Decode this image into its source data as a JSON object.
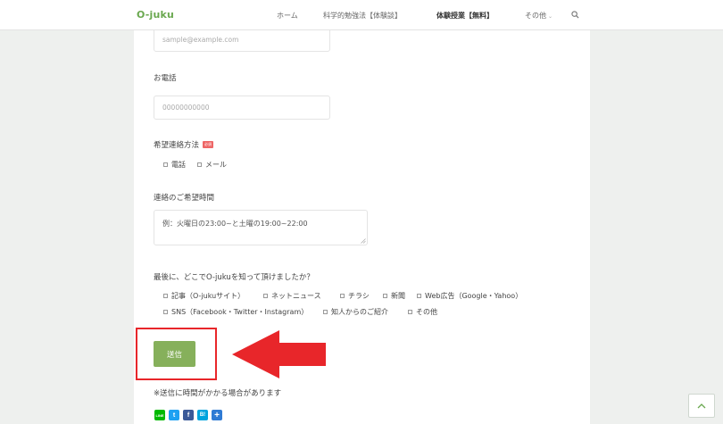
{
  "header": {
    "logo": "O-juku",
    "nav": [
      "ホーム",
      "科学的勉強法【体験談】",
      "体験授業【無料】",
      "その他"
    ],
    "more_caret": "⌄"
  },
  "form": {
    "email_placeholder": "sample@example.com",
    "phone_label": "お電話",
    "phone_placeholder": "00000000000",
    "contact_method_label": "希望連絡方法",
    "required_badge": "必須",
    "contact_methods": [
      "電話",
      "メール"
    ],
    "time_label": "連絡のご希望時間",
    "time_placeholder": "例：火曜日の23:00~と土曜の19:00~22:00",
    "referral_label": "最後に、どこでO-jukuを知って頂けましたか？",
    "referral_options": [
      "記事（O-jukuサイト）",
      "ネットニュース",
      "チラシ",
      "新聞",
      "Web広告（Google・Yahoo）",
      "SNS（Facebook・Twitter・Instagram）",
      "知人からのご紹介",
      "その他"
    ],
    "submit_label": "送信",
    "note": "※送信に時間がかかる場合があります"
  },
  "share": [
    {
      "icon": "line-icon",
      "text": "LINE",
      "color": "#00b900"
    },
    {
      "icon": "twitter-icon",
      "text": "t",
      "color": "#1da1f2"
    },
    {
      "icon": "facebook-icon",
      "text": "f",
      "color": "#3b5998"
    },
    {
      "icon": "hatena-icon",
      "text": "B!",
      "color": "#00a4de"
    },
    {
      "icon": "pocket-add-icon",
      "text": "+",
      "color": "#2f7bd4"
    }
  ],
  "colors": {
    "accent": "#6aa84f",
    "button": "#86b05b",
    "highlight": "#e8262a"
  }
}
